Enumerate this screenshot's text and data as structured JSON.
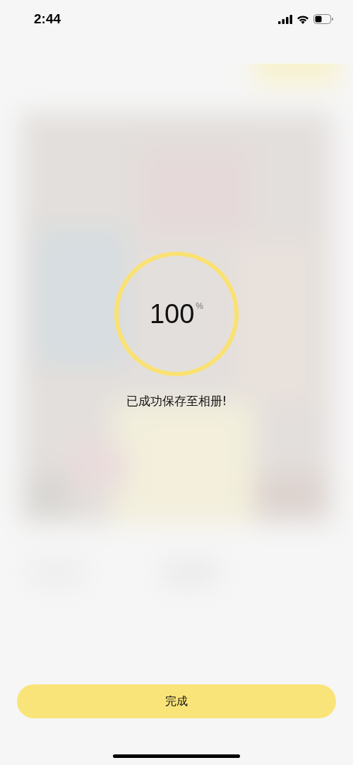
{
  "status_bar": {
    "time": "2:44"
  },
  "progress": {
    "level": 1,
    "value": "100",
    "unit": "%"
  },
  "message": "已成功保存至相册!",
  "done_button": {
    "label": "完成"
  }
}
